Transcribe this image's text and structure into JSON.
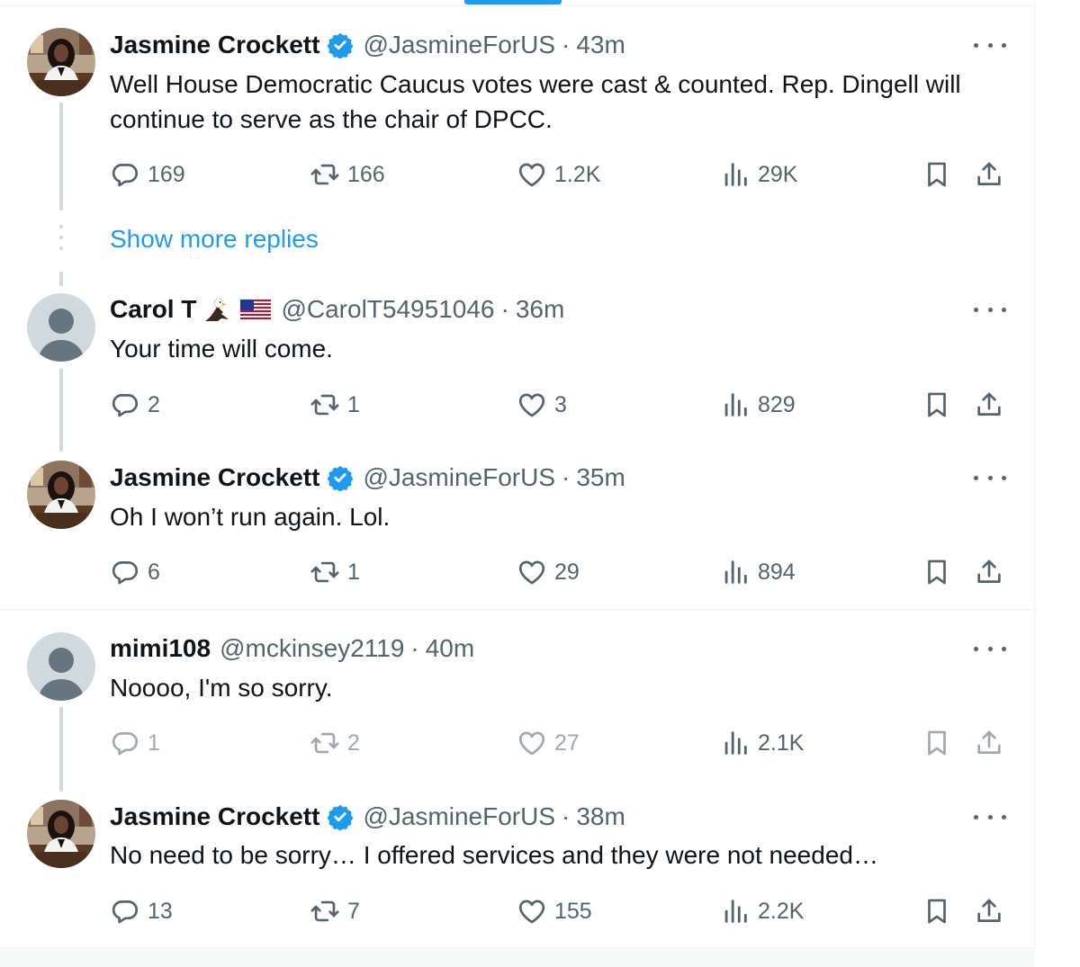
{
  "thread": {
    "show_more_replies": "Show more replies",
    "tweets": [
      {
        "name": "Jasmine Crockett",
        "handle": "@JasmineForUS",
        "time": "43m",
        "verified": true,
        "text": "Well House Democratic Caucus votes were cast & counted.  Rep. Dingell will continue to serve as the chair of DPCC.",
        "replies": "169",
        "retweets": "166",
        "likes": "1.2K",
        "views": "29K"
      },
      {
        "name": "Carol T",
        "handle": "@CarolT54951046",
        "time": "36m",
        "verified": false,
        "name_emoji": [
          "eagle-emoji",
          "us-flag-emoji"
        ],
        "text": "Your time will come.",
        "replies": "2",
        "retweets": "1",
        "likes": "3",
        "views": "829"
      },
      {
        "name": "Jasmine Crockett",
        "handle": "@JasmineForUS",
        "time": "35m",
        "verified": true,
        "text": "Oh I won’t run again. Lol.",
        "replies": "6",
        "retweets": "1",
        "likes": "29",
        "views": "894"
      },
      {
        "name": "mimi108",
        "handle": "@mckinsey2119",
        "time": "40m",
        "verified": false,
        "text": "Noooo, I'm so sorry.",
        "replies": "1",
        "retweets": "2",
        "likes": "27",
        "views": "2.1K"
      },
      {
        "name": "Jasmine Crockett",
        "handle": "@JasmineForUS",
        "time": "38m",
        "verified": true,
        "text": "No need to be sorry… I offered services and they were not needed…",
        "replies": "13",
        "retweets": "7",
        "likes": "155",
        "views": "2.2K"
      }
    ]
  },
  "colors": {
    "accent": "#1d9bf0",
    "text_primary": "#0f1419",
    "text_secondary": "#536471",
    "border": "#eff3f4",
    "thread_line": "#cfd9de"
  },
  "icons": [
    "reply-icon",
    "retweet-icon",
    "like-icon",
    "views-icon",
    "bookmark-icon",
    "share-icon",
    "more-icon",
    "verified-badge-icon"
  ]
}
